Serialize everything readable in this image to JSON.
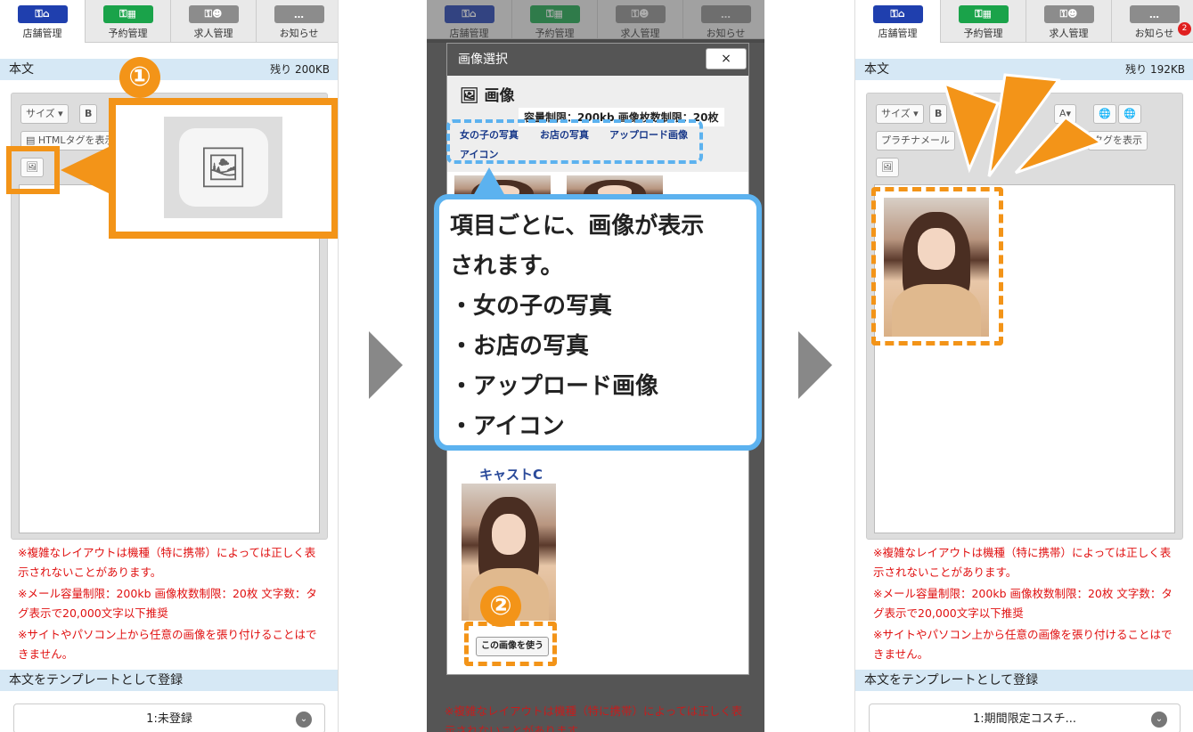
{
  "tabs": [
    "店舗管理",
    "予約管理",
    "求人管理",
    "お知らせ"
  ],
  "notice_count": "2",
  "left": {
    "body_label": "本文",
    "remaining": "残り 200KB",
    "size_btn": "サイズ",
    "bold_btn": "B",
    "html_btn": "HTMLタグを表示",
    "step": "①",
    "notes": [
      "※複雑なレイアウトは機種（特に携帯）によっては正しく表示されないことがあります。",
      "※メール容量制限：200kb 画像枚数制限：20枚 文字数：タグ表示で20,000文字以下推奨",
      "※サイトやパソコン上から任意の画像を張り付けることはできません。"
    ],
    "template_label": "本文をテンプレートとして登録",
    "template_value": "1:未登録"
  },
  "middle": {
    "modal_title": "画像選択",
    "close": "×",
    "heading": "画像",
    "limits": "容量制限：200kb 画像枚数制限：20枚",
    "categories": [
      "女の子の写真",
      "お店の写真",
      "アップロード画像",
      "アイコン"
    ],
    "callout_lines": [
      "項目ごとに、画像が表示",
      "されます。",
      "・女の子の写真",
      "・お店の写真",
      "・アップロード画像",
      "・アイコン"
    ],
    "cast_name": "キャストC",
    "step": "②",
    "use_btn": "この画像を使う",
    "bg_note": "※複雑なレイアウトは機種（特に携帯）によっては正しく表示されないことがあります。"
  },
  "right": {
    "body_label": "本文",
    "remaining": "残り 192KB",
    "size_btn": "サイズ",
    "bold_btn": "B",
    "platinum_btn": "プラチナメール",
    "tag_btn": "タグを表示",
    "template_label": "本文をテンプレートとして登録",
    "template_value": "1:期間限定コスチ..."
  }
}
